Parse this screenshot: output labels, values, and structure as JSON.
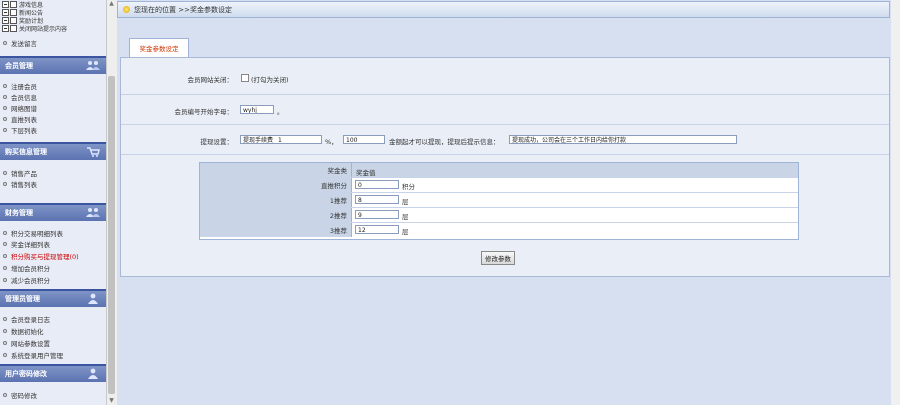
{
  "sidebar": {
    "tree_items": [
      {
        "label": "游戏信息"
      },
      {
        "label": "新闻公告"
      },
      {
        "label": "奖励计划"
      },
      {
        "label": "关闭网站提示内容"
      }
    ],
    "top_links": [
      "发送留言"
    ],
    "sections": [
      {
        "title": "会员管理",
        "icon": "users-icon",
        "links": [
          "注册会员",
          "会员信息",
          "网络图谱",
          "直推列表",
          "下层列表"
        ]
      },
      {
        "title": "购买信息管理",
        "icon": "cart-icon",
        "links": [
          "销售产品",
          "销售列表"
        ]
      },
      {
        "title": "财务管理",
        "icon": "finance-icon",
        "links": [
          "积分交易明细列表",
          "奖金详细列表",
          "积分购买与提现管理(0)",
          "增加会员积分",
          "减少会员积分"
        ]
      },
      {
        "title": "管理员管理",
        "icon": "admin-icon",
        "links": [
          "会员登录日志",
          "数据初始化",
          "网站参数设置",
          "系统登录用户管理"
        ]
      },
      {
        "title": "用户密码修改",
        "icon": "password-icon",
        "links": [
          "密码修改"
        ]
      }
    ]
  },
  "breadcrumb": "您现在的位置 >>奖金参数设定",
  "tab_label": "奖金参数设定",
  "form": {
    "site_closed_label": "会员网站关闭：",
    "site_closed_hint": "(打勾为关闭)",
    "prefix_label": "会员编号开始字母：",
    "prefix_value": "wyhj",
    "prefix_suffix": "。",
    "withdraw_label": "提现设置：",
    "withdraw_fee_label": "提现手续费",
    "withdraw_fee_value": "1",
    "withdraw_percent": "%，",
    "withdraw_min_value": "100",
    "withdraw_min_text": "金额起才可以提现，提现后提示信息：",
    "withdraw_message": "提现成功，公司会在三个工作日内给你打款"
  },
  "bonus_table": {
    "header_type": "奖金类",
    "header_value": "奖金值",
    "rows": [
      {
        "label": "直推积分",
        "value": "0",
        "unit": "积分"
      },
      {
        "label": "1推荐",
        "value": "8",
        "unit": "层"
      },
      {
        "label": "2推荐",
        "value": "9",
        "unit": "层"
      },
      {
        "label": "3推荐",
        "value": "12",
        "unit": "层"
      }
    ]
  },
  "save_label": "修改参数"
}
